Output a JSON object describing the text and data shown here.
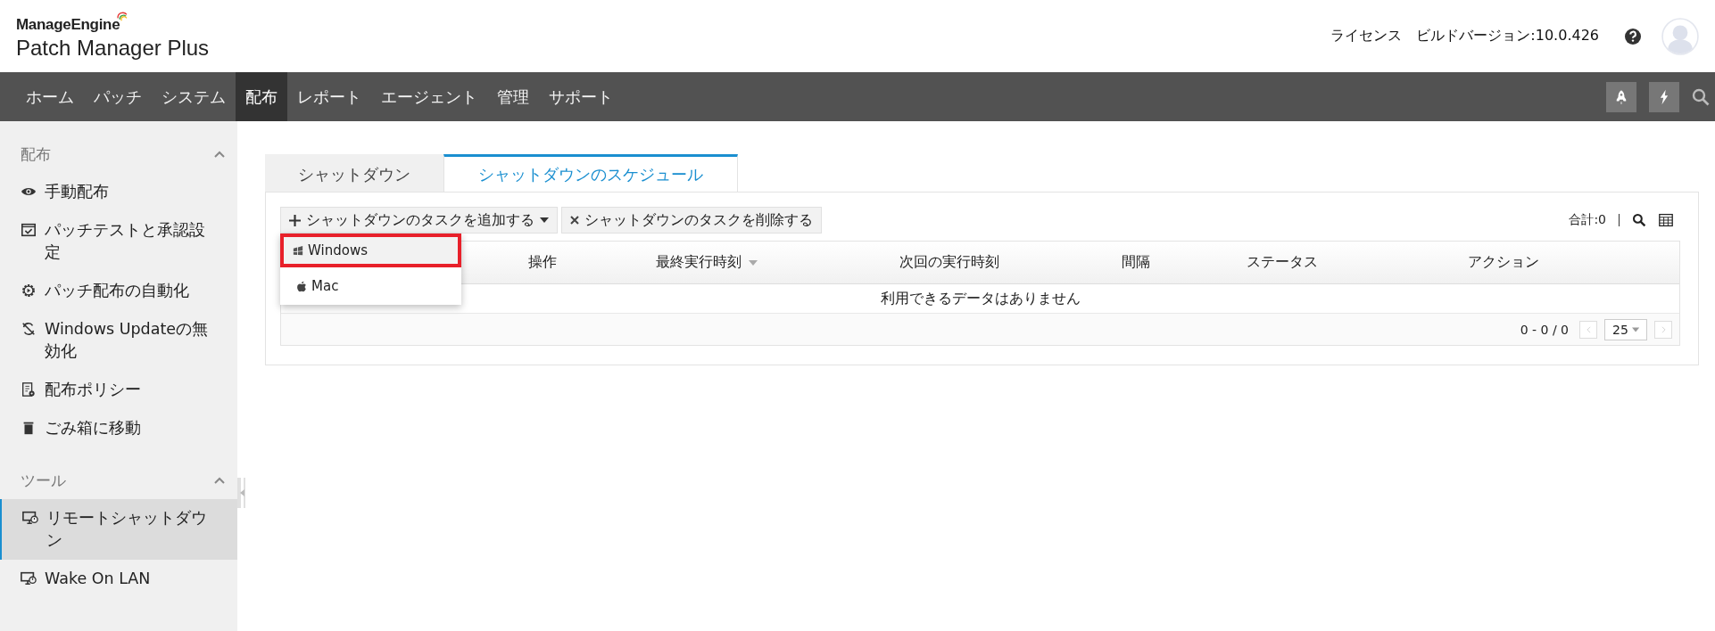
{
  "header": {
    "brand": "ManageEngine",
    "product": "Patch Manager Plus",
    "links": [
      "ライセンス",
      "ビルドバージョン:10.0.426"
    ]
  },
  "nav": {
    "items": [
      {
        "label": "ホーム",
        "selected": false
      },
      {
        "label": "パッチ",
        "selected": false
      },
      {
        "label": "システム",
        "selected": false
      },
      {
        "label": "配布",
        "selected": true
      },
      {
        "label": "レポート",
        "selected": false
      },
      {
        "label": "エージェント",
        "selected": false
      },
      {
        "label": "管理",
        "selected": false
      },
      {
        "label": "サポート",
        "selected": false
      }
    ]
  },
  "sidebar": {
    "sections": [
      {
        "title": "配布",
        "expanded": true,
        "items": [
          {
            "label": "手動配布",
            "kind": "eye",
            "selected": false
          },
          {
            "label": "パッチテストと承認設定",
            "kind": "window-check",
            "selected": false
          },
          {
            "label": "パッチ配布の自動化",
            "kind": "gear-play",
            "selected": false
          },
          {
            "label": "Windows Updateの無効化",
            "kind": "sync-off",
            "selected": false
          },
          {
            "label": "配布ポリシー",
            "kind": "doc-gear",
            "selected": false
          },
          {
            "label": "ごみ箱に移動",
            "kind": "trash",
            "selected": false
          }
        ]
      },
      {
        "title": "ツール",
        "expanded": true,
        "items": [
          {
            "label": "リモートシャットダウン",
            "kind": "monitor-clock",
            "selected": true
          },
          {
            "label": "Wake On LAN",
            "kind": "monitor-power",
            "selected": false
          }
        ]
      }
    ]
  },
  "tabs": [
    {
      "label": "シャットダウン",
      "selected": false
    },
    {
      "label": "シャットダウンのスケジュール",
      "selected": true
    }
  ],
  "toolbar": {
    "add_button": "シャットダウンのタスクを追加する",
    "delete_button": "シャットダウンのタスクを削除する",
    "total": "合計:0"
  },
  "dropdown": {
    "items": [
      {
        "label": "Windows",
        "kind": "windows",
        "highlighted": true
      },
      {
        "label": "Mac",
        "kind": "apple",
        "highlighted": false
      }
    ]
  },
  "table": {
    "columns": [
      {
        "label": "操作",
        "sorted": false
      },
      {
        "label": "最終実行時刻",
        "sorted": true
      },
      {
        "label": "次回の実行時刻",
        "sorted": false
      },
      {
        "label": "間隔",
        "sorted": false
      },
      {
        "label": "ステータス",
        "sorted": false
      },
      {
        "label": "アクション",
        "sorted": false
      }
    ],
    "empty_message": "利用できるデータはありません",
    "pagination": {
      "range": "0 - 0 / 0",
      "page_size": "25"
    }
  }
}
